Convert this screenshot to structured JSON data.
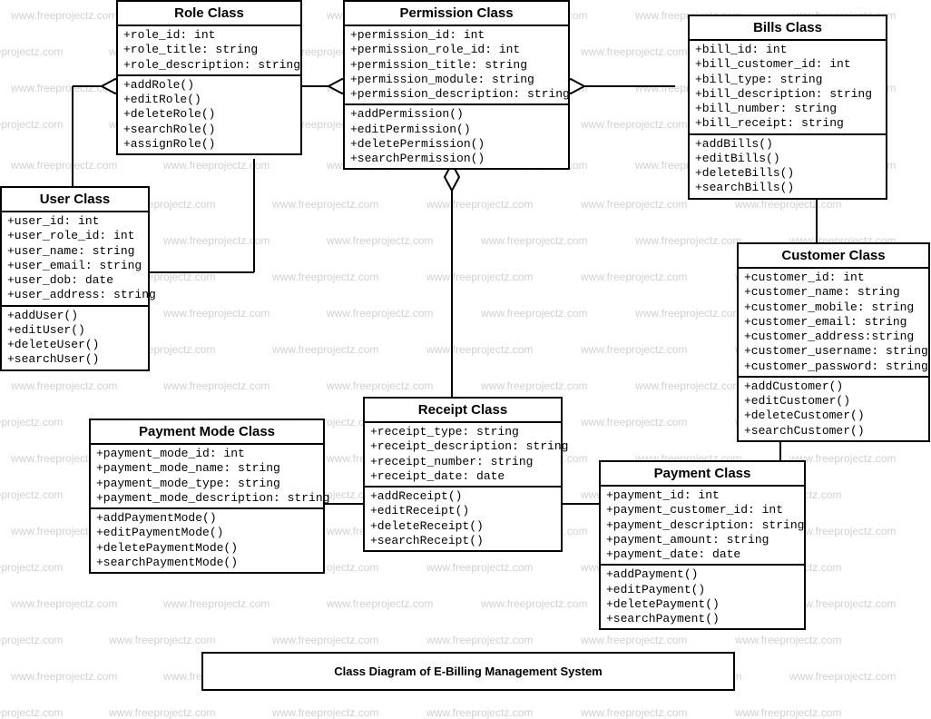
{
  "watermark": "www.freeprojectz.com",
  "title": "Class Diagram of E-Billing Management System",
  "classes": {
    "role": {
      "name": "Role Class",
      "attrs": [
        "+role_id: int",
        "+role_title: string",
        "+role_description: string"
      ],
      "ops": [
        "+addRole()",
        "+editRole()",
        "+deleteRole()",
        "+searchRole()",
        "+assignRole()"
      ]
    },
    "permission": {
      "name": "Permission Class",
      "attrs": [
        "+permission_id: int",
        "+permission_role_id: int",
        "+permission_title: string",
        "+permission_module: string",
        "+permission_description: string"
      ],
      "ops": [
        "+addPermission()",
        "+editPermission()",
        "+deletePermission()",
        "+searchPermission()"
      ]
    },
    "bills": {
      "name": "Bills Class",
      "attrs": [
        "+bill_id: int",
        "+bill_customer_id: int",
        "+bill_type: string",
        "+bill_description: string",
        "+bill_number: string",
        "+bill_receipt: string"
      ],
      "ops": [
        "+addBills()",
        "+editBills()",
        "+deleteBills()",
        "+searchBills()"
      ]
    },
    "user": {
      "name": "User Class",
      "attrs": [
        "+user_id: int",
        "+user_role_id: int",
        "+user_name: string",
        "+user_email: string",
        "+user_dob: date",
        "+user_address: string"
      ],
      "ops": [
        "+addUser()",
        "+editUser()",
        "+deleteUser()",
        "+searchUser()"
      ]
    },
    "customer": {
      "name": "Customer Class",
      "attrs": [
        "+customer_id: int",
        "+customer_name: string",
        "+customer_mobile: string",
        "+customer_email: string",
        "+customer_address:string",
        "+customer_username: string",
        "+customer_password: string"
      ],
      "ops": [
        "+addCustomer()",
        "+editCustomer()",
        "+deleteCustomer()",
        "+searchCustomer()"
      ]
    },
    "paymentmode": {
      "name": "Payment Mode Class",
      "attrs": [
        "+payment_mode_id: int",
        "+payment_mode_name: string",
        "+payment_mode_type: string",
        "+payment_mode_description: string"
      ],
      "ops": [
        "+addPaymentMode()",
        "+editPaymentMode()",
        "+deletePaymentMode()",
        "+searchPaymentMode()"
      ]
    },
    "receipt": {
      "name": "Receipt Class",
      "attrs": [
        "+receipt_type: string",
        "+receipt_description: string",
        "+receipt_number: string",
        "+receipt_date: date"
      ],
      "ops": [
        "+addReceipt()",
        "+editReceipt()",
        "+deleteReceipt()",
        "+searchReceipt()"
      ]
    },
    "payment": {
      "name": "Payment Class",
      "attrs": [
        "+payment_id: int",
        "+payment_customer_id: int",
        "+payment_description: string",
        "+payment_amount: string",
        "+payment_date: date"
      ],
      "ops": [
        "+addPayment()",
        "+editPayment()",
        "+deletePayment()",
        "+searchPayment()"
      ]
    }
  }
}
